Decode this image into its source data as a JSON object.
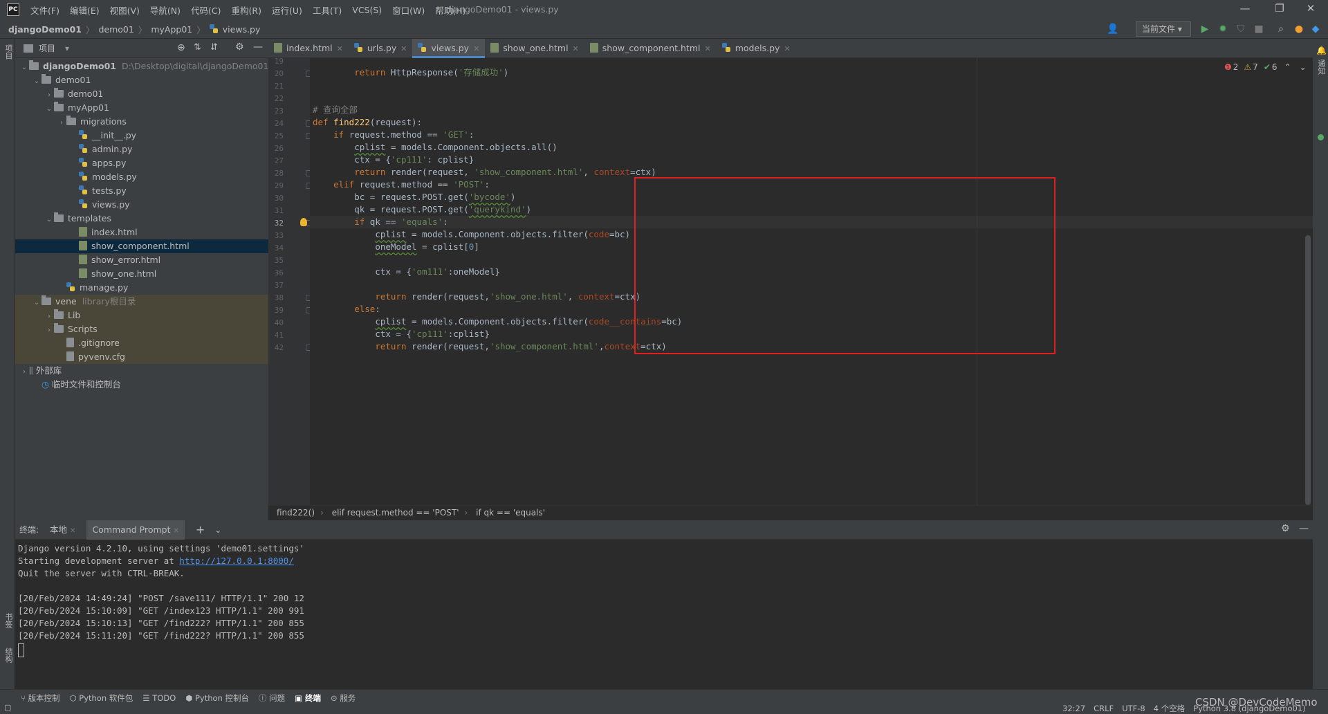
{
  "menubar": {
    "logo": "PC",
    "items": [
      "文件(F)",
      "编辑(E)",
      "视图(V)",
      "导航(N)",
      "代码(C)",
      "重构(R)",
      "运行(U)",
      "工具(T)",
      "VCS(S)",
      "窗口(W)",
      "帮助(H)"
    ],
    "title": "djangoDemo01 - views.py"
  },
  "nav": {
    "crumbs": [
      "djangoDemo01",
      "demo01",
      "myApp01",
      "views.py"
    ],
    "run_config": "当前文件"
  },
  "project": {
    "header": "项目",
    "nodes": [
      {
        "label": "djangoDemo01",
        "extra": "D:\\Desktop\\digital\\djangoDemo01",
        "depth": 0,
        "arrow": "v",
        "icon": "folder",
        "bold": true
      },
      {
        "label": "demo01",
        "extra": "",
        "depth": 1,
        "arrow": "v",
        "icon": "folder"
      },
      {
        "label": "demo01",
        "extra": "",
        "depth": 2,
        "arrow": ">",
        "icon": "folder"
      },
      {
        "label": "myApp01",
        "extra": "",
        "depth": 2,
        "arrow": "v",
        "icon": "folder"
      },
      {
        "label": "migrations",
        "extra": "",
        "depth": 3,
        "arrow": ">",
        "icon": "folder"
      },
      {
        "label": "__init__.py",
        "extra": "",
        "depth": 4,
        "arrow": "",
        "icon": "py"
      },
      {
        "label": "admin.py",
        "extra": "",
        "depth": 4,
        "arrow": "",
        "icon": "py"
      },
      {
        "label": "apps.py",
        "extra": "",
        "depth": 4,
        "arrow": "",
        "icon": "py"
      },
      {
        "label": "models.py",
        "extra": "",
        "depth": 4,
        "arrow": "",
        "icon": "py"
      },
      {
        "label": "tests.py",
        "extra": "",
        "depth": 4,
        "arrow": "",
        "icon": "py"
      },
      {
        "label": "views.py",
        "extra": "",
        "depth": 4,
        "arrow": "",
        "icon": "py"
      },
      {
        "label": "templates",
        "extra": "",
        "depth": 2,
        "arrow": "v",
        "icon": "folder"
      },
      {
        "label": "index.html",
        "extra": "",
        "depth": 4,
        "arrow": "",
        "icon": "html"
      },
      {
        "label": "show_component.html",
        "extra": "",
        "depth": 4,
        "arrow": "",
        "icon": "html",
        "selected": true
      },
      {
        "label": "show_error.html",
        "extra": "",
        "depth": 4,
        "arrow": "",
        "icon": "html"
      },
      {
        "label": "show_one.html",
        "extra": "",
        "depth": 4,
        "arrow": "",
        "icon": "html"
      },
      {
        "label": "manage.py",
        "extra": "",
        "depth": 3,
        "arrow": "",
        "icon": "py"
      },
      {
        "label": "vene",
        "extra": "library根目录",
        "depth": 1,
        "arrow": "v",
        "icon": "folder",
        "lib": true
      },
      {
        "label": "Lib",
        "extra": "",
        "depth": 2,
        "arrow": ">",
        "icon": "folder",
        "lib": true
      },
      {
        "label": "Scripts",
        "extra": "",
        "depth": 2,
        "arrow": ">",
        "icon": "folder",
        "lib": true
      },
      {
        "label": ".gitignore",
        "extra": "",
        "depth": 3,
        "arrow": "",
        "icon": "cfg",
        "lib": true
      },
      {
        "label": "pyvenv.cfg",
        "extra": "",
        "depth": 3,
        "arrow": "",
        "icon": "cfg",
        "lib": true
      },
      {
        "label": "外部库",
        "extra": "",
        "depth": 0,
        "arrow": ">",
        "icon": "lib"
      },
      {
        "label": "临时文件和控制台",
        "extra": "",
        "depth": 1,
        "arrow": "",
        "icon": "scratch"
      }
    ]
  },
  "tabs": [
    {
      "label": "index.html",
      "icon": "html"
    },
    {
      "label": "urls.py",
      "icon": "py"
    },
    {
      "label": "views.py",
      "icon": "py",
      "active": true
    },
    {
      "label": "show_one.html",
      "icon": "html"
    },
    {
      "label": "show_component.html",
      "icon": "html"
    },
    {
      "label": "models.py",
      "icon": "py"
    }
  ],
  "editor": {
    "indicators": {
      "errors": "2",
      "warnings": "7",
      "ok": "6"
    },
    "lines": [
      {
        "n": "19",
        "t": []
      },
      {
        "n": "20",
        "t": [
          [
            "        ",
            ""
          ],
          [
            "return",
            "kw"
          ],
          [
            " HttpResponse(",
            ""
          ],
          [
            "'存储成功'",
            "str"
          ],
          [
            ")",
            ""
          ]
        ]
      },
      {
        "n": "21",
        "t": []
      },
      {
        "n": "22",
        "t": []
      },
      {
        "n": "23",
        "t": [
          [
            "# 查询全部",
            "cm"
          ]
        ]
      },
      {
        "n": "24",
        "t": [
          [
            "def",
            "kw"
          ],
          [
            " ",
            ""
          ],
          [
            "find222",
            "fn"
          ],
          [
            "(request):",
            ""
          ]
        ]
      },
      {
        "n": "25",
        "t": [
          [
            "    ",
            ""
          ],
          [
            "if",
            "kw"
          ],
          [
            " request.method == ",
            ""
          ],
          [
            "'GET'",
            "str"
          ],
          [
            ":",
            ""
          ]
        ]
      },
      {
        "n": "26",
        "t": [
          [
            "        ",
            ""
          ],
          [
            "cplist",
            "uw"
          ],
          [
            " = models.Component.objects.all()",
            ""
          ]
        ]
      },
      {
        "n": "27",
        "t": [
          [
            "        ctx = {",
            ""
          ],
          [
            "'cp111'",
            "str"
          ],
          [
            ": cplist}",
            ""
          ]
        ]
      },
      {
        "n": "28",
        "t": [
          [
            "        ",
            ""
          ],
          [
            "return",
            "kw"
          ],
          [
            " render(request, ",
            ""
          ],
          [
            "'show_component.html'",
            "str"
          ],
          [
            ", ",
            ""
          ],
          [
            "context",
            "pm"
          ],
          [
            "=ctx)",
            ""
          ]
        ]
      },
      {
        "n": "29",
        "t": [
          [
            "    ",
            ""
          ],
          [
            "elif",
            "kw"
          ],
          [
            " request.method == ",
            ""
          ],
          [
            "'POST'",
            "str"
          ],
          [
            ":",
            ""
          ]
        ]
      },
      {
        "n": "30",
        "t": [
          [
            "        bc = request.POST.get(",
            ""
          ],
          [
            "'bycode'",
            "str uw"
          ],
          [
            ")",
            ""
          ]
        ]
      },
      {
        "n": "31",
        "t": [
          [
            "        qk = request.POST.get(",
            ""
          ],
          [
            "'querykind'",
            "str uw"
          ],
          [
            ")",
            ""
          ]
        ]
      },
      {
        "n": "32",
        "t": [
          [
            "        ",
            ""
          ],
          [
            "if",
            "kw"
          ],
          [
            " qk == ",
            ""
          ],
          [
            "'equals'",
            "str"
          ],
          [
            ":",
            ""
          ]
        ],
        "current": true
      },
      {
        "n": "33",
        "t": [
          [
            "            ",
            ""
          ],
          [
            "cplist",
            "uw"
          ],
          [
            " = models.Component.objects.filter(",
            ""
          ],
          [
            "code",
            "pm"
          ],
          [
            "=bc)",
            ""
          ]
        ]
      },
      {
        "n": "34",
        "t": [
          [
            "            ",
            ""
          ],
          [
            "oneModel",
            "uw"
          ],
          [
            " = cplist[",
            ""
          ],
          [
            "0",
            "num"
          ],
          [
            "]",
            ""
          ]
        ]
      },
      {
        "n": "35",
        "t": []
      },
      {
        "n": "36",
        "t": [
          [
            "            ctx = {",
            ""
          ],
          [
            "'om111'",
            "str"
          ],
          [
            ":oneModel}",
            ""
          ]
        ]
      },
      {
        "n": "37",
        "t": []
      },
      {
        "n": "38",
        "t": [
          [
            "            ",
            ""
          ],
          [
            "return",
            "kw"
          ],
          [
            " render(request,",
            ""
          ],
          [
            "'show_one.html'",
            "str"
          ],
          [
            ", ",
            ""
          ],
          [
            "context",
            "pm"
          ],
          [
            "=ctx)",
            ""
          ]
        ]
      },
      {
        "n": "39",
        "t": [
          [
            "        ",
            ""
          ],
          [
            "else",
            "kw"
          ],
          [
            ":",
            ""
          ]
        ]
      },
      {
        "n": "40",
        "t": [
          [
            "            ",
            ""
          ],
          [
            "cplist",
            "uw"
          ],
          [
            " = models.Component.objects.filter(",
            ""
          ],
          [
            "code__contains",
            "pm"
          ],
          [
            "=bc)",
            ""
          ]
        ]
      },
      {
        "n": "41",
        "t": [
          [
            "            ctx = {",
            ""
          ],
          [
            "'cp111'",
            "str"
          ],
          [
            ":cplist}",
            ""
          ]
        ]
      },
      {
        "n": "42",
        "t": [
          [
            "            ",
            ""
          ],
          [
            "return",
            "kw"
          ],
          [
            " render(request,",
            ""
          ],
          [
            "'show_component.html'",
            "str"
          ],
          [
            ",",
            ""
          ],
          [
            "context",
            "pm"
          ],
          [
            "=ctx)",
            ""
          ]
        ]
      }
    ],
    "breadcrumb": [
      "find222()",
      "elif request.method == 'POST'",
      "if qk == 'equals'"
    ]
  },
  "terminal": {
    "label": "终端:",
    "tabs": [
      "本地",
      "Command Prompt"
    ],
    "lines": [
      {
        "text": "Django version 4.2.10, using settings 'demo01.settings'"
      },
      {
        "text": "Starting development server at ",
        "link": "http://127.0.0.1:8000/"
      },
      {
        "text": "Quit the server with CTRL-BREAK."
      },
      {
        "text": ""
      },
      {
        "text": "[20/Feb/2024 14:49:24] \"POST /save111/ HTTP/1.1\" 200 12"
      },
      {
        "text": "[20/Feb/2024 15:10:09] \"GET /index123 HTTP/1.1\" 200 991"
      },
      {
        "text": "[20/Feb/2024 15:10:13] \"GET /find222? HTTP/1.1\" 200 855"
      },
      {
        "text": "[20/Feb/2024 15:11:20] \"GET /find222? HTTP/1.1\" 200 855"
      }
    ]
  },
  "bottom_tools": [
    "版本控制",
    "Python 软件包",
    "TODO",
    "Python 控制台",
    "问题",
    "终端",
    "服务"
  ],
  "status": {
    "items": [
      "32:27",
      "CRLF",
      "UTF-8",
      "4 个空格",
      "Python 3.8 (djangoDemo01)"
    ]
  },
  "watermark": "CSDN @DevCodeMemo",
  "strips": {
    "left_top": "项目",
    "left_bottom1": "书签",
    "left_bottom2": "结构",
    "right": "通知"
  }
}
